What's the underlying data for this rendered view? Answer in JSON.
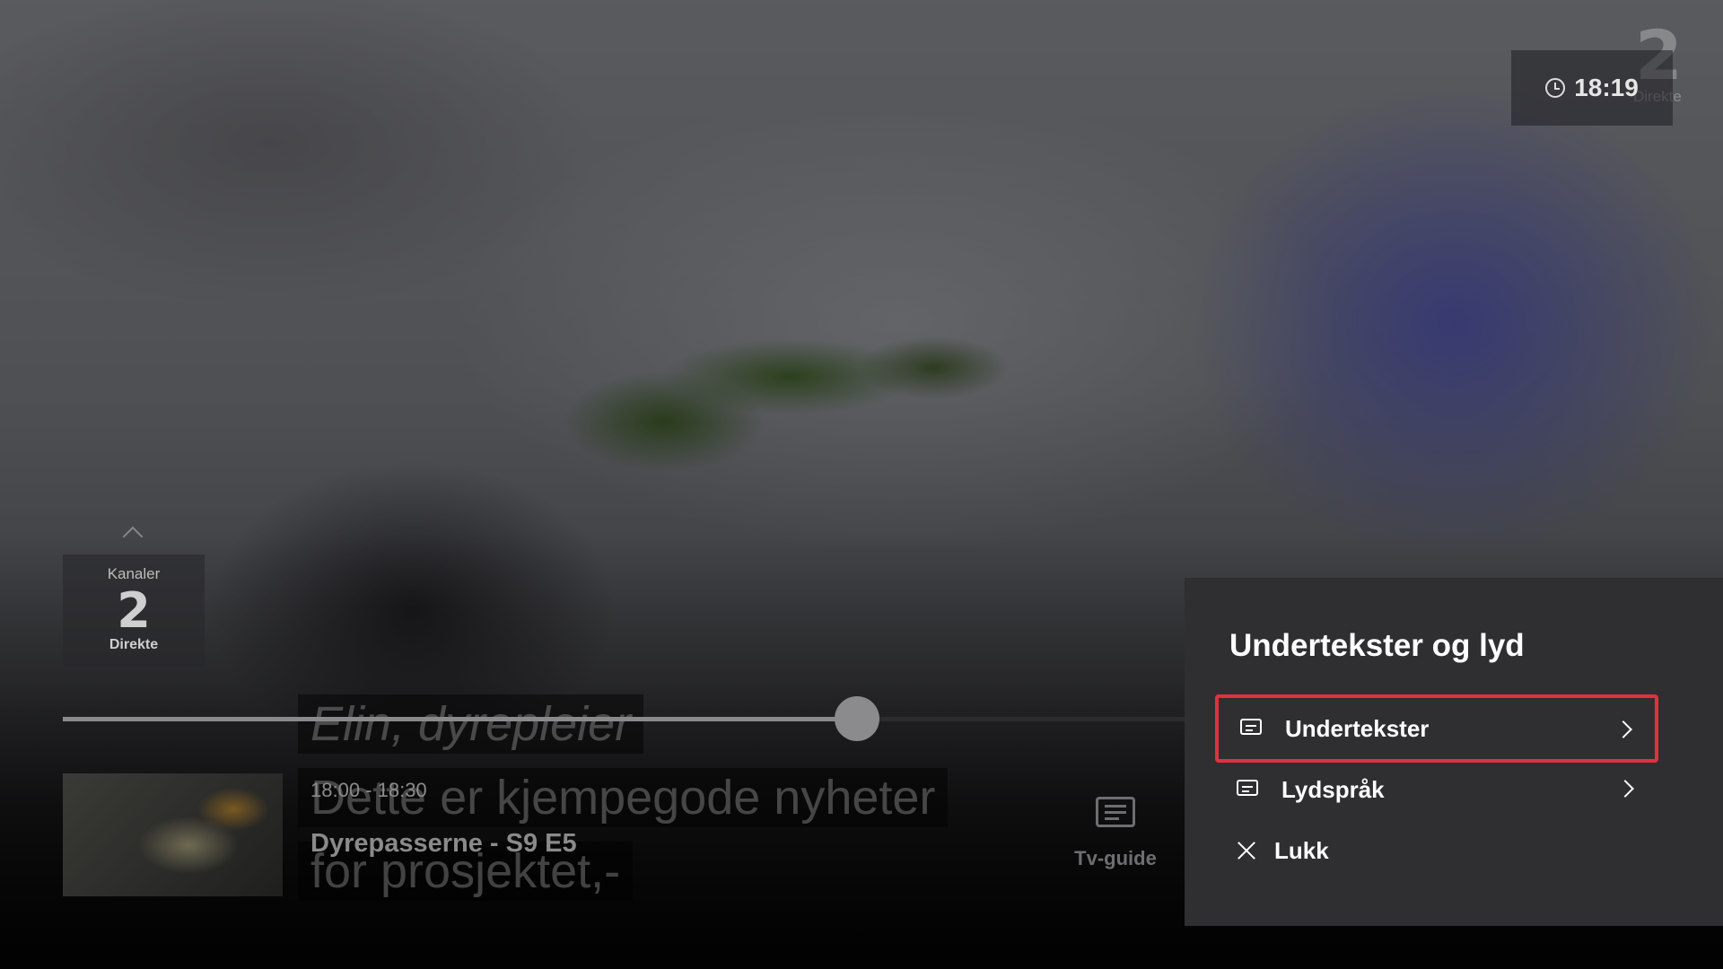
{
  "clock": {
    "time": "18:19"
  },
  "top_logo": {
    "mark": "2",
    "label": "Direkte"
  },
  "channels": {
    "title": "Kanaler",
    "logo": "2",
    "status": "Direkte"
  },
  "subtitles_overlay": [
    "Elin, dyrepleier",
    "Dette er kjempegode nyheter",
    "for prosjektet,-"
  ],
  "progress": {
    "fraction": 0.708
  },
  "program": {
    "time": "18:00 - 18:30",
    "title": "Dyrepasserne - S9 E5",
    "thumbnail_icon": "frog-thumbnail"
  },
  "tvguide": {
    "label": "Tv-guide",
    "icon": "tv-guide-icon"
  },
  "panel": {
    "title": "Undertekster og lyd",
    "items": [
      {
        "label": "Undertekster",
        "icon": "subtitles-icon",
        "focused": true
      },
      {
        "label": "Lydspråk",
        "icon": "subtitles-icon",
        "focused": false
      },
      {
        "label": "Lukk",
        "icon": "close-icon",
        "focused": false
      }
    ]
  },
  "colors": {
    "focus": "#e0323c",
    "panel_bg": "#2f2f31"
  }
}
